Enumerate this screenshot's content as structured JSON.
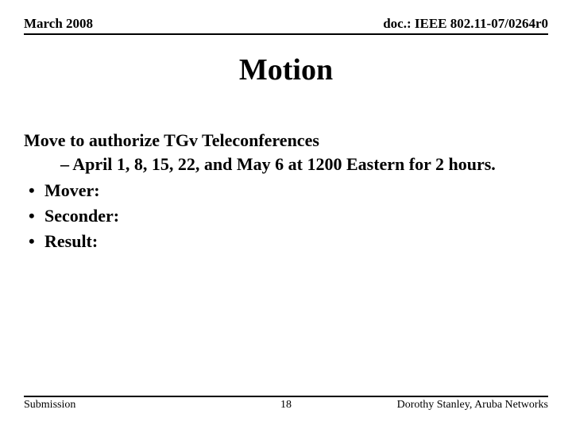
{
  "header": {
    "date": "March 2008",
    "doc_ref": "doc.: IEEE 802.11-07/0264r0"
  },
  "title": "Motion",
  "motion": {
    "lead": "Move to authorize TGv Teleconferences",
    "schedule": "– April 1, 8, 15, 22, and May 6 at 1200 Eastern for 2 hours.",
    "bullets": {
      "mover": "Mover:",
      "seconder": "Seconder:",
      "result": "Result:"
    }
  },
  "footer": {
    "left": "Submission",
    "page": "18",
    "right": "Dorothy Stanley, Aruba Networks"
  }
}
